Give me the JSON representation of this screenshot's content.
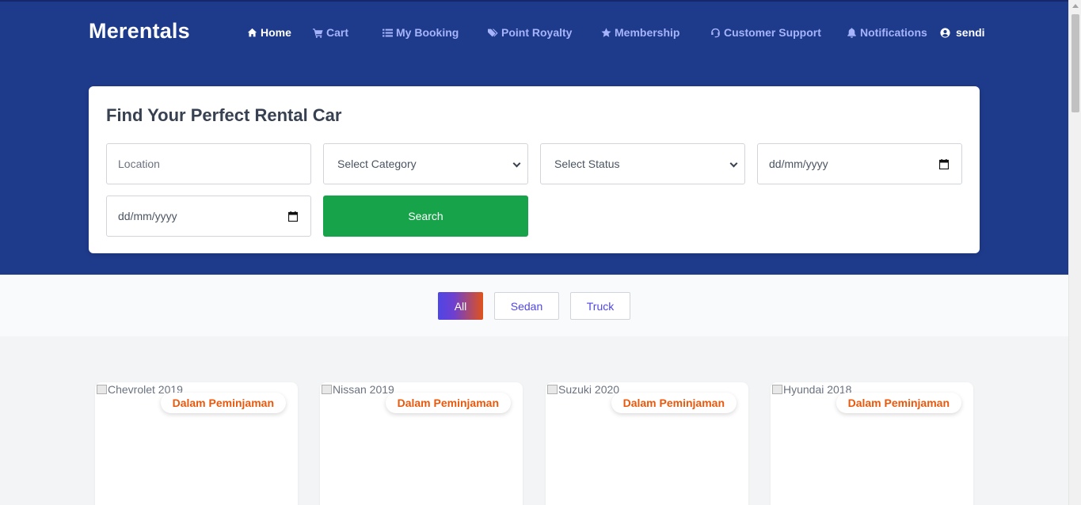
{
  "brand": "Merentals",
  "nav": {
    "home": "Home",
    "cart": "Cart",
    "my_booking": "My Booking",
    "point_royalty": "Point Royalty",
    "membership": "Membership",
    "customer_support": "Customer Support",
    "notifications": "Notifications",
    "user": "sendi"
  },
  "search": {
    "title": "Find Your Perfect Rental Car",
    "location_placeholder": "Location",
    "category_selected": "Select Category",
    "status_selected": "Select Status",
    "start_date_placeholder": "dd/mm/yyyy",
    "end_date_placeholder": "dd/mm/yyyy",
    "button": "Search"
  },
  "filters": [
    "All",
    "Sedan",
    "Truck"
  ],
  "active_filter": "All",
  "cars": [
    {
      "alt": "Chevrolet 2019",
      "status": "Dalam Peminjaman"
    },
    {
      "alt": "Nissan 2019",
      "status": "Dalam Peminjaman"
    },
    {
      "alt": "Suzuki 2020",
      "status": "Dalam Peminjaman"
    },
    {
      "alt": "Hyundai 2018",
      "status": "Dalam Peminjaman"
    }
  ],
  "colors": {
    "header_bg": "#1e3a8a",
    "nav_link": "#a5b4fc",
    "search_button": "#16a34a",
    "status_text": "#ea580c",
    "filter_link": "#4f46e5"
  }
}
